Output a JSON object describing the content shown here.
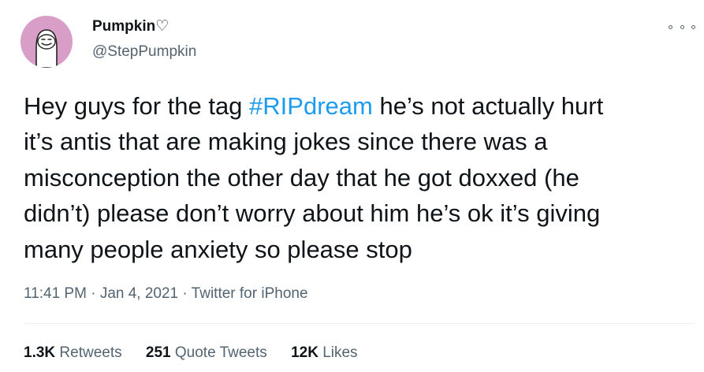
{
  "user": {
    "name": "Pumpkin♡",
    "handle": "@StepPumpkin",
    "avatar_color": "#d89ec8"
  },
  "tweet": {
    "lines": [
      [
        "Hey guys for the tag ",
        "#RIPdream",
        " he’s not actually hurt"
      ],
      [
        "it’s antis that are making jokes since there was a"
      ],
      [
        "misconception the other day that he got doxxed (he"
      ],
      [
        "didn’t) please don’t worry about him he’s ok it’s giving"
      ],
      [
        "many people anxiety so please stop"
      ]
    ],
    "hashtag_color": "#1d9bf0"
  },
  "meta": {
    "time": "11:41 PM",
    "separator": "·",
    "date": "Jan 4, 2021",
    "source": "Twitter for iPhone"
  },
  "stats": {
    "retweets": {
      "count": "1.3K",
      "label": "Retweets"
    },
    "quote_tweets": {
      "count": "251",
      "label": "Quote Tweets"
    },
    "likes": {
      "count": "12K",
      "label": "Likes"
    }
  },
  "icons": {
    "more": "more-horizontal-icon"
  }
}
